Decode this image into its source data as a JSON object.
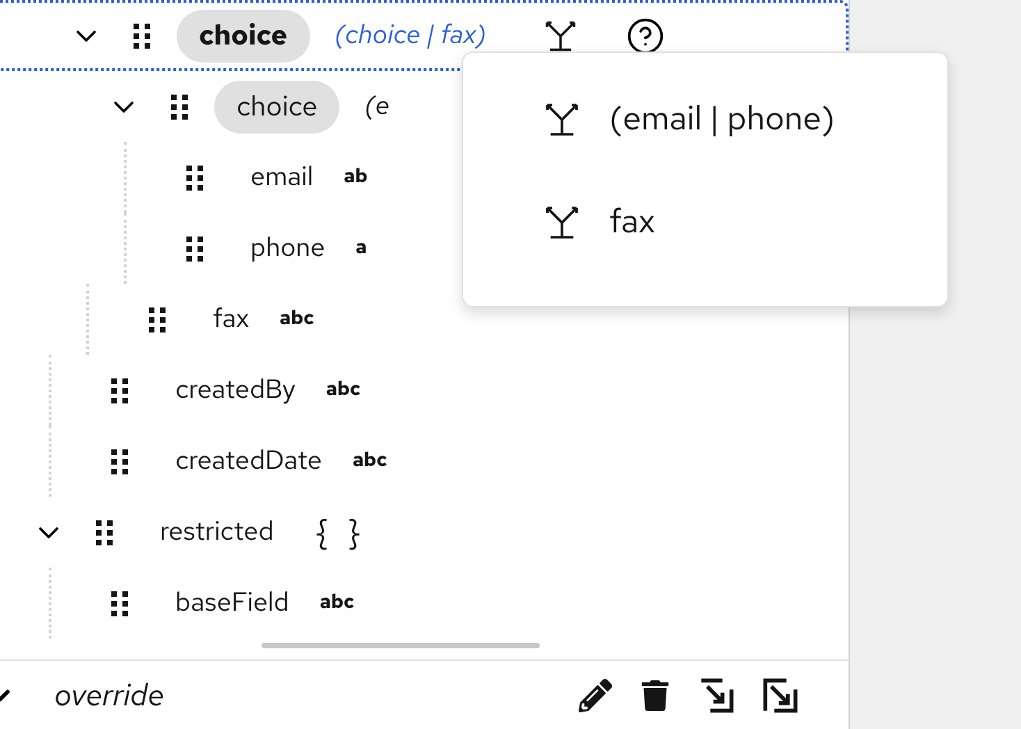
{
  "tree": [
    {
      "children": [
        {
          "kind": "choice",
          "label": "choice",
          "summary": "(choice | fax)",
          "expanded": true,
          "selected": true,
          "children": [
            {
              "kind": "choice",
              "label": "choice",
              "summary": "(e",
              "expanded": true,
              "selected": false,
              "children": [
                {
                  "kind": "field",
                  "label": "email",
                  "type": "ab"
                },
                {
                  "kind": "field",
                  "label": "phone",
                  "type": "a"
                }
              ]
            },
            {
              "kind": "field",
              "label": "fax",
              "type": "abc"
            }
          ]
        },
        {
          "kind": "field",
          "label": "createdBy",
          "type": "abc"
        },
        {
          "kind": "field",
          "label": "createdDate",
          "type": "abc"
        }
      ]
    },
    {
      "kind": "object",
      "label": "restricted",
      "type": "{ }",
      "expanded": true,
      "children": [
        {
          "kind": "field",
          "label": "baseField",
          "type": "abc"
        }
      ]
    }
  ],
  "menu": {
    "items": [
      {
        "label": "(email | phone)"
      },
      {
        "label": "fax"
      }
    ]
  },
  "footer": {
    "label": "override",
    "expanded": true
  }
}
